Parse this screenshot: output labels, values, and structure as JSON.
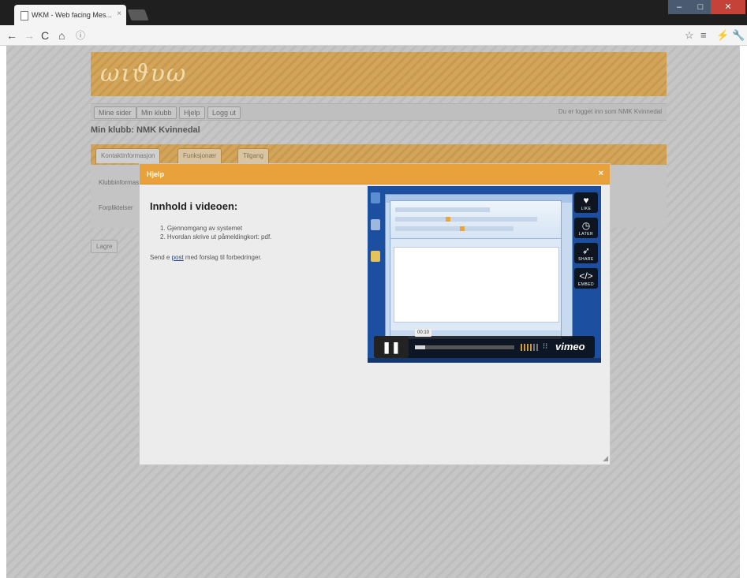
{
  "browser": {
    "tab_title": "WKM - Web facing Mes...",
    "tab_close": "×",
    "window_controls": [
      "–",
      "□",
      "✕"
    ],
    "nav_buttons": {
      "back": "←",
      "forward": "→",
      "reload": "C",
      "home": "⌂",
      "info": "ⓘ"
    },
    "right_icons": [
      "☆",
      "≡",
      "⚡",
      "🔧"
    ]
  },
  "site": {
    "logo_text": "ωιϑυω",
    "nav": [
      "Mine sider",
      "Min klubb",
      "Hjelp",
      "Logg ut"
    ],
    "nav_right": "Du er logget inn som NMK Kvinnedal",
    "club_heading": "Min klubb: NMK Kvinnedal",
    "tabs": [
      "Kontaktinformasjon",
      "Funksjonær",
      "Tilgang"
    ],
    "rows": [
      "Klubbinformasjon",
      "Forpliktelser"
    ],
    "small_button": "Lagre"
  },
  "modal": {
    "title": "Hjelp",
    "close": "×",
    "heading": "Innhold i videoen:",
    "list": [
      "1. Gjennomgang av systemet",
      "2. Hvordan skrive ut påmeldingkort: pdf."
    ],
    "note_prefix": "Send e ",
    "note_link": "post",
    "note_suffix": " med forslag til forbedringer.",
    "resize": "◢"
  },
  "video": {
    "side_buttons": [
      {
        "icon": "♥",
        "label": "LIKE"
      },
      {
        "icon": "◷",
        "label": "LATER"
      },
      {
        "icon": "➶",
        "label": "SHARE"
      },
      {
        "icon": "</>",
        "label": "EMBED"
      }
    ],
    "play_icon": "❚❚",
    "time": "00:10",
    "progress": 0.1,
    "hd_icon": "⁝⁝",
    "brand": "vimeo",
    "colors": {
      "accent": "#e9a23b",
      "banner": "#d2a55a"
    }
  }
}
